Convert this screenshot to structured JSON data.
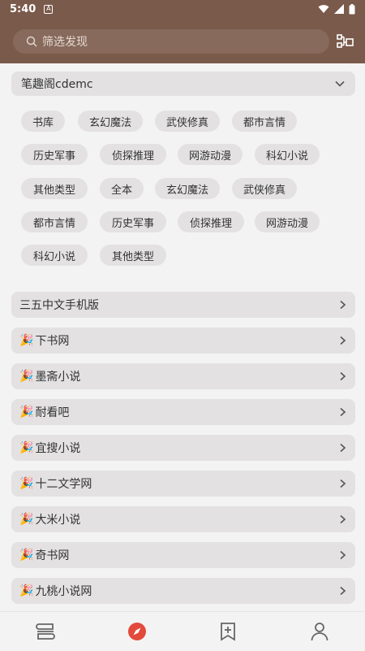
{
  "status": {
    "time": "5:40",
    "noti": "A"
  },
  "search": {
    "placeholder": "筛选发现"
  },
  "group": {
    "title": "笔趣阁cdemc"
  },
  "tags": [
    "书库",
    "玄幻魔法",
    "武侠修真",
    "都市言情",
    "历史军事",
    "侦探推理",
    "网游动漫",
    "科幻小说",
    "其他类型",
    "全本",
    "玄幻魔法",
    "武侠修真",
    "都市言情",
    "历史军事",
    "侦探推理",
    "网游动漫",
    "科幻小说",
    "其他类型"
  ],
  "sources": [
    {
      "emoji": "",
      "label": "三五中文手机版"
    },
    {
      "emoji": "🎉",
      "label": "下书网"
    },
    {
      "emoji": "🎉",
      "label": "墨斋小说"
    },
    {
      "emoji": "🎉",
      "label": "耐看吧"
    },
    {
      "emoji": "🎉",
      "label": "宜搜小说"
    },
    {
      "emoji": "🎉",
      "label": "十二文学网"
    },
    {
      "emoji": "🎉",
      "label": "大米小说"
    },
    {
      "emoji": "🎉",
      "label": "奇书网"
    },
    {
      "emoji": "🎉",
      "label": "九桃小说网"
    }
  ],
  "nav": {
    "items": [
      {
        "icon": "bookshelf-icon"
      },
      {
        "icon": "discover-compass-icon"
      },
      {
        "icon": "bookmark-add-icon"
      },
      {
        "icon": "profile-icon"
      }
    ],
    "active_color": "#e24a3b"
  },
  "colors": {
    "header": "#7a5a4b",
    "chip": "#e3e1e1",
    "background": "#f4f3f3"
  }
}
